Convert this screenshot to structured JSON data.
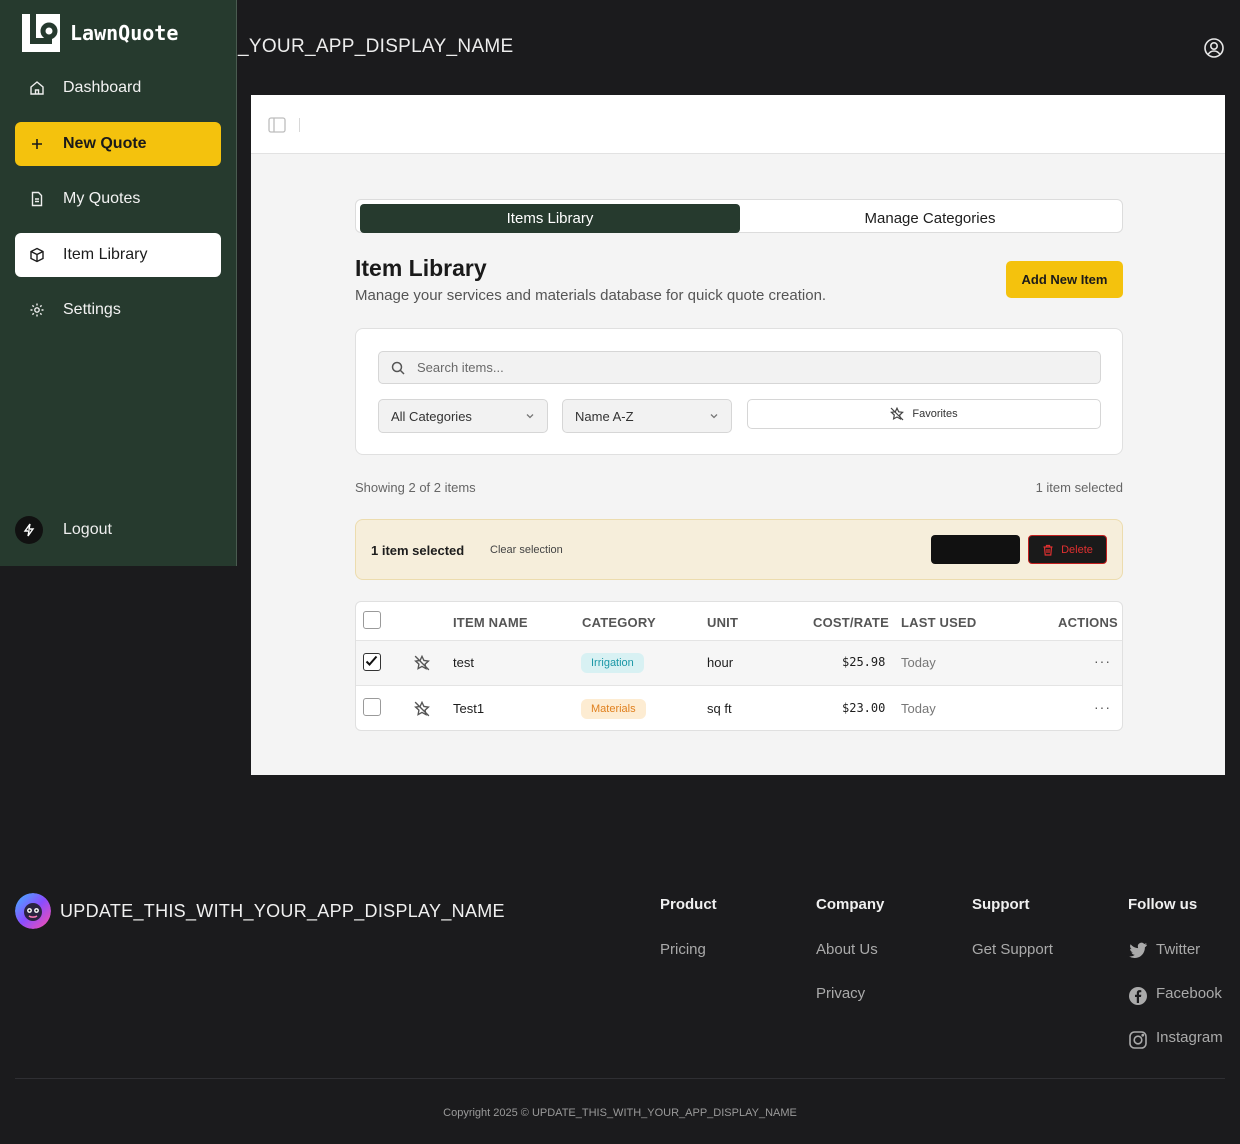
{
  "topbar": {
    "app_title": "_YOUR_APP_DISPLAY_NAME"
  },
  "sidebar": {
    "brand": "LawnQuote",
    "items": [
      {
        "label": "Dashboard",
        "icon": "home-icon"
      },
      {
        "label": "New Quote",
        "icon": "plus-icon"
      },
      {
        "label": "My Quotes",
        "icon": "document-icon"
      },
      {
        "label": "Item Library",
        "icon": "package-icon"
      },
      {
        "label": "Settings",
        "icon": "gear-icon"
      }
    ],
    "logout": "Logout"
  },
  "tabs": [
    {
      "label": "Items Library"
    },
    {
      "label": "Manage Categories"
    }
  ],
  "page": {
    "title": "Item Library",
    "subtitle": "Manage your services and materials database for quick quote creation.",
    "add_button": "Add New Item"
  },
  "filters": {
    "search_placeholder": "Search items...",
    "category": "All Categories",
    "sort": "Name A-Z",
    "favorites": "Favorites"
  },
  "summary": {
    "showing": "Showing 2 of 2 items",
    "selected": "1 item selected"
  },
  "selection_bar": {
    "text": "1 item selected",
    "clear": "Clear selection",
    "delete": "Delete"
  },
  "table": {
    "headers": [
      "ITEM NAME",
      "CATEGORY",
      "UNIT",
      "COST/RATE",
      "LAST USED",
      "ACTIONS"
    ],
    "rows": [
      {
        "checked": true,
        "name": "test",
        "category": "Irrigation",
        "unit": "hour",
        "cost": "$25.98",
        "last_used": "Today",
        "actions": "···"
      },
      {
        "checked": false,
        "name": "Test1",
        "category": "Materials",
        "unit": "sq ft",
        "cost": "$23.00",
        "last_used": "Today",
        "actions": "···"
      }
    ]
  },
  "footer": {
    "app_name": "UPDATE_THIS_WITH_YOUR_APP_DISPLAY_NAME",
    "columns": [
      {
        "heading": "Product",
        "links": [
          "Pricing"
        ]
      },
      {
        "heading": "Company",
        "links": [
          "About Us",
          "Privacy"
        ]
      },
      {
        "heading": "Support",
        "links": [
          "Get Support"
        ]
      },
      {
        "heading": "Follow us",
        "links": [
          "Twitter",
          "Facebook",
          "Instagram"
        ]
      }
    ],
    "copyright": "Copyright 2025 © UPDATE_THIS_WITH_YOUR_APP_DISPLAY_NAME"
  },
  "colors": {
    "sidebar_bg": "#263a2e",
    "accent_yellow": "#f4c20d",
    "page_bg": "#1b1b1d",
    "irrigation_badge": "#1a97a6",
    "materials_badge": "#e0801e",
    "danger": "#e03030"
  }
}
